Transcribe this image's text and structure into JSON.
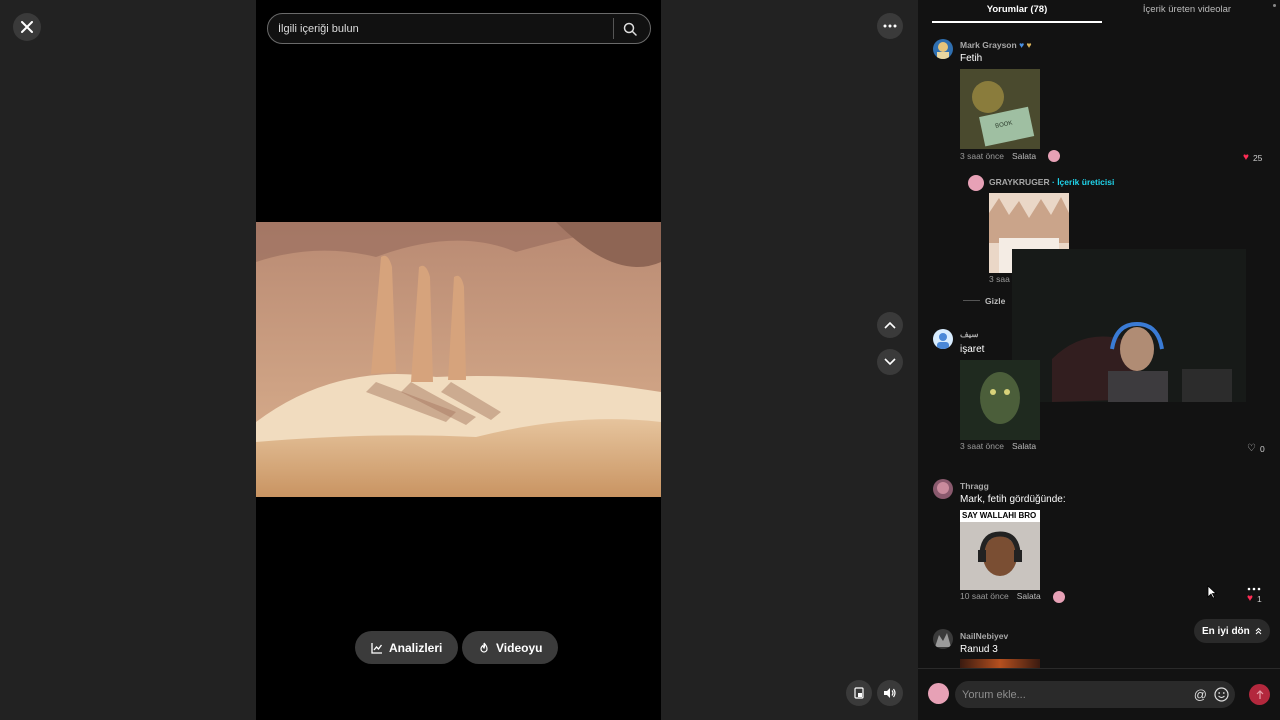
{
  "search": {
    "placeholder": "İlgili içeriği bulun"
  },
  "buttons": {
    "analytics": "Analizleri",
    "video": "Videoyu"
  },
  "tabs": [
    {
      "label": "Yorumlar (78)"
    },
    {
      "label": "İçerik üreten videolar"
    }
  ],
  "comments": [
    {
      "author": "Mark Grayson",
      "text": "Fetih",
      "time": "3 saat önce",
      "tag": "Salata",
      "likes": "25",
      "liked": true
    },
    {
      "author": "GRAYKRUGER",
      "creator_label": "· İçerik üreticisi",
      "time": "3 saa"
    },
    {
      "hide_label": "Gizle"
    },
    {
      "author": "سيف",
      "text": "işaret",
      "time": "3 saat önce",
      "tag": "Salata",
      "likes": "0",
      "liked": false
    },
    {
      "author": "Thragg",
      "text": "Mark, fetih gördüğünde:",
      "meme_caption": "SAY WALLAHI BRO",
      "time": "10 saat önce",
      "tag": "Salata",
      "likes": "1",
      "liked": true
    },
    {
      "author": "NailNebiyev",
      "text": "Ranud 3"
    }
  ],
  "scroll_top": {
    "label": "En iyi dön"
  },
  "composer": {
    "placeholder": "Yorum ekle..."
  },
  "colors": {
    "like_red": "#fe2c55",
    "creator_blue": "#20d5ec",
    "send_btn": "#b3283d"
  }
}
